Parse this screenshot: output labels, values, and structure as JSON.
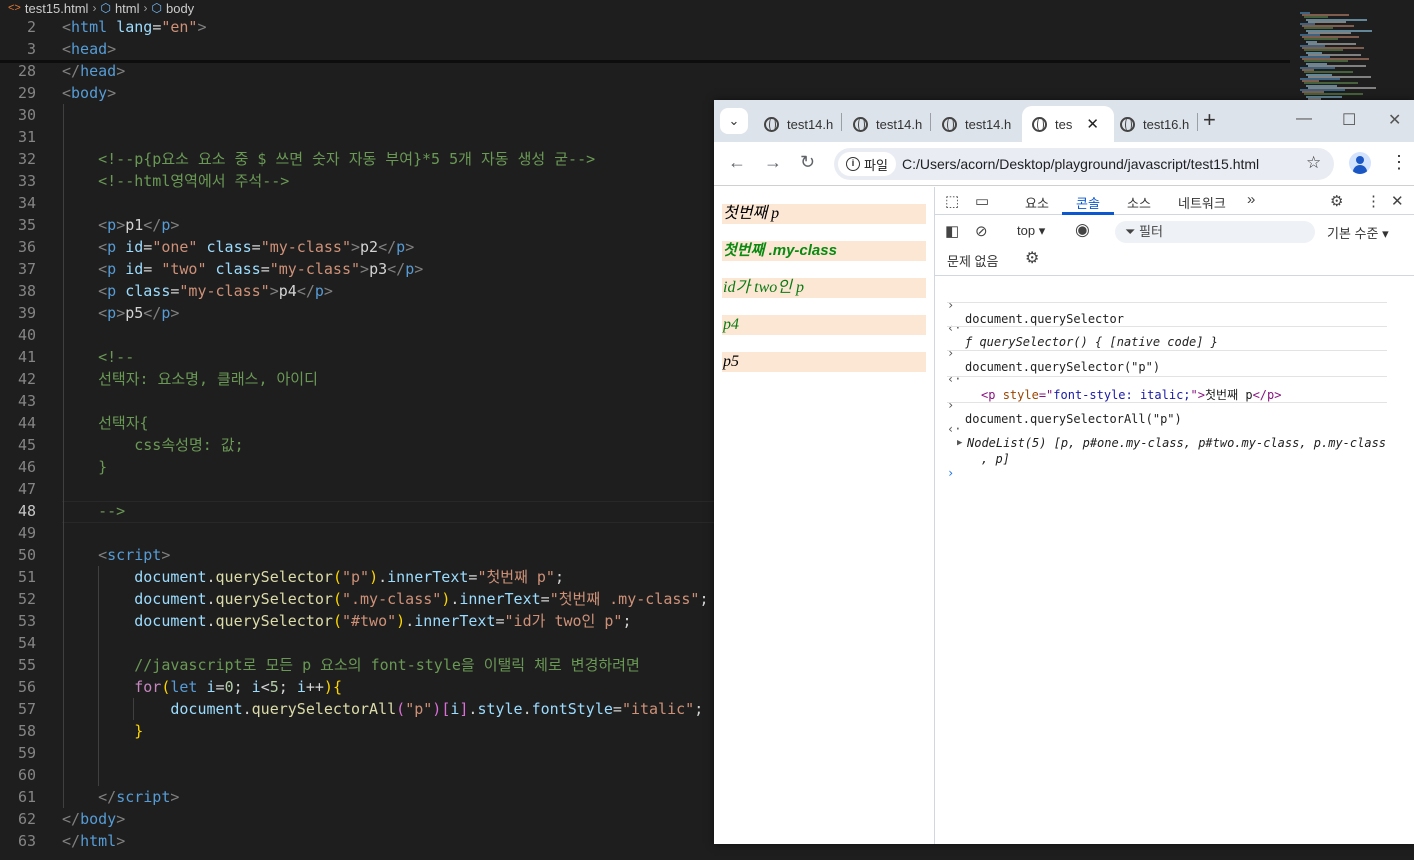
{
  "editor": {
    "breadcrumb": [
      "test15.html",
      "html",
      "body"
    ],
    "lines": [
      {
        "n": "2",
        "html": "<span class='t'>&lt;</span><span class='tg'>html</span> <span class='at'>lang</span><span class='tx'>=</span><span class='st'>\"en\"</span><span class='t'>&gt;</span>"
      },
      {
        "n": "3",
        "html": "<span class='t'>&lt;</span><span class='tg'>head</span><span class='t'>&gt;</span>"
      },
      {
        "n": "28",
        "html": "<span class='t'>&lt;/</span><span class='tg'>head</span><span class='t'>&gt;</span>"
      },
      {
        "n": "29",
        "html": "<span class='t'>&lt;</span><span class='tg'>body</span><span class='t'>&gt;</span>"
      },
      {
        "n": "30",
        "html": ""
      },
      {
        "n": "31",
        "html": ""
      },
      {
        "n": "32",
        "html": "    <span class='cm'>&lt;!--p{p요소 요소 중 $ 쓰면 숫자 자동 부여}*5 5개 자동 생성 굳--&gt;</span>"
      },
      {
        "n": "33",
        "html": "    <span class='cm'>&lt;!--html영역에서 주석--&gt;</span>"
      },
      {
        "n": "34",
        "html": ""
      },
      {
        "n": "35",
        "html": "    <span class='t'>&lt;</span><span class='tg'>p</span><span class='t'>&gt;</span><span class='tx'>p1</span><span class='t'>&lt;/</span><span class='tg'>p</span><span class='t'>&gt;</span>"
      },
      {
        "n": "36",
        "html": "    <span class='t'>&lt;</span><span class='tg'>p</span> <span class='at'>id</span><span class='tx'>=</span><span class='st'>\"one\"</span> <span class='at'>class</span><span class='tx'>=</span><span class='st'>\"my-class\"</span><span class='t'>&gt;</span><span class='tx'>p2</span><span class='t'>&lt;/</span><span class='tg'>p</span><span class='t'>&gt;</span>"
      },
      {
        "n": "37",
        "html": "    <span class='t'>&lt;</span><span class='tg'>p</span> <span class='at'>id</span><span class='tx'>= </span><span class='st'>\"two\"</span> <span class='at'>class</span><span class='tx'>=</span><span class='st'>\"my-class\"</span><span class='t'>&gt;</span><span class='tx'>p3</span><span class='t'>&lt;/</span><span class='tg'>p</span><span class='t'>&gt;</span>"
      },
      {
        "n": "38",
        "html": "    <span class='t'>&lt;</span><span class='tg'>p</span> <span class='at'>class</span><span class='tx'>=</span><span class='st'>\"my-class\"</span><span class='t'>&gt;</span><span class='tx'>p4</span><span class='t'>&lt;/</span><span class='tg'>p</span><span class='t'>&gt;</span>"
      },
      {
        "n": "39",
        "html": "    <span class='t'>&lt;</span><span class='tg'>p</span><span class='t'>&gt;</span><span class='tx'>p5</span><span class='t'>&lt;/</span><span class='tg'>p</span><span class='t'>&gt;</span>"
      },
      {
        "n": "40",
        "html": ""
      },
      {
        "n": "41",
        "html": "    <span class='cm'>&lt;!--</span>"
      },
      {
        "n": "42",
        "html": "    <span class='cm'>선택자: 요소명, 클래스, 아이디</span>"
      },
      {
        "n": "43",
        "html": ""
      },
      {
        "n": "44",
        "html": "    <span class='cm'>선택자{</span>"
      },
      {
        "n": "45",
        "html": "        <span class='cm'>css속성명: 값;</span>"
      },
      {
        "n": "46",
        "html": "    <span class='cm'>}</span>"
      },
      {
        "n": "47",
        "html": ""
      },
      {
        "n": "48",
        "html": "    <span class='cm'>--&gt;</span>"
      },
      {
        "n": "49",
        "html": ""
      },
      {
        "n": "50",
        "html": "    <span class='t'>&lt;</span><span class='tg'>script</span><span class='t'>&gt;</span>"
      },
      {
        "n": "51",
        "html": "        <span class='vr'>document</span><span class='tx'>.</span><span class='fn'>querySelector</span><span class='br1'>(</span><span class='st'>\"p\"</span><span class='br1'>)</span><span class='tx'>.</span><span class='vr'>innerText</span><span class='tx'>=</span><span class='st'>\"첫번째 p\"</span><span class='tx'>;</span>"
      },
      {
        "n": "52",
        "html": "        <span class='vr'>document</span><span class='tx'>.</span><span class='fn'>querySelector</span><span class='br1'>(</span><span class='st'>\".my-class\"</span><span class='br1'>)</span><span class='tx'>.</span><span class='vr'>innerText</span><span class='tx'>=</span><span class='st'>\"첫번째 .my-class\"</span><span class='tx'>;</span>"
      },
      {
        "n": "53",
        "html": "        <span class='vr'>document</span><span class='tx'>.</span><span class='fn'>querySelector</span><span class='br1'>(</span><span class='st'>\"#two\"</span><span class='br1'>)</span><span class='tx'>.</span><span class='vr'>innerText</span><span class='tx'>=</span><span class='st'>\"id가 two인 p\"</span><span class='tx'>;</span>"
      },
      {
        "n": "54",
        "html": ""
      },
      {
        "n": "55",
        "html": "        <span class='cm'>//javascript로 모든 p 요소의 font-style을 이탤릭 체로 변경하려면</span>"
      },
      {
        "n": "56",
        "html": "        <span class='ct'>for</span><span class='br1'>(</span><span class='kw'>let</span> <span class='vr'>i</span><span class='tx'>=</span><span class='nm'>0</span><span class='tx'>; </span><span class='vr'>i</span><span class='tx'>&lt;</span><span class='nm'>5</span><span class='tx'>; </span><span class='vr'>i</span><span class='tx'>++</span><span class='br1'>)</span><span class='br1'>{</span>"
      },
      {
        "n": "57",
        "html": "            <span class='vr'>document</span><span class='tx'>.</span><span class='fn'>querySelectorAll</span><span class='br2'>(</span><span class='st'>\"p\"</span><span class='br2'>)</span><span class='br2'>[</span><span class='vr'>i</span><span class='br2'>]</span><span class='tx'>.</span><span class='vr'>style</span><span class='tx'>.</span><span class='vr'>fontStyle</span><span class='tx'>=</span><span class='st'>\"italic\"</span><span class='tx'>;</span>"
      },
      {
        "n": "58",
        "html": "        <span class='br1'>}</span>"
      },
      {
        "n": "59",
        "html": ""
      },
      {
        "n": "60",
        "html": ""
      },
      {
        "n": "61",
        "html": "    <span class='t'>&lt;/</span><span class='tg'>script</span><span class='t'>&gt;</span>"
      },
      {
        "n": "62",
        "html": "<span class='t'>&lt;/</span><span class='tg'>body</span><span class='t'>&gt;</span>"
      },
      {
        "n": "63",
        "html": "<span class='t'>&lt;/</span><span class='tg'>html</span><span class='t'>&gt;</span>"
      }
    ]
  },
  "browser": {
    "tabs": [
      {
        "label": "test14.h"
      },
      {
        "label": "test14.h"
      },
      {
        "label": "test14.h"
      },
      {
        "label": "tes"
      },
      {
        "label": "test16.h"
      }
    ],
    "active_tab": 3,
    "new_tab": "+",
    "url_chip": "파일",
    "url": "C:/Users/acorn/Desktop/playground/javascript/test15.html",
    "page_paragraphs": [
      {
        "text": "첫번째 p"
      },
      {
        "text": "첫번째 .my-class"
      },
      {
        "text": "id가 two인 p"
      },
      {
        "text": "p4"
      },
      {
        "text": "p5"
      }
    ]
  },
  "devtools": {
    "tabs": [
      "요소",
      "콘솔",
      "소스",
      "네트워크"
    ],
    "active_tab": "콘솔",
    "context": "top",
    "filter_placeholder": "필터",
    "level": "기본 수준",
    "issues": "문제 없음",
    "console": {
      "l1": "document.querySelector",
      "l2": "ƒ querySelector() { [native code] }",
      "l3": "document.querySelector(\"p\")",
      "l4a": "<p ",
      "l4b": "style",
      "l4c": "=\"",
      "l4d": "font-style: italic;",
      "l4e": "\">",
      "l4f": "첫번째 p",
      "l4g": "</p>",
      "l5": "document.querySelectorAll(\"p\")",
      "l6": "NodeList(5) [p, p#one.my-class, p#two.my-class, p.my-class",
      "l7": ", p]"
    }
  }
}
